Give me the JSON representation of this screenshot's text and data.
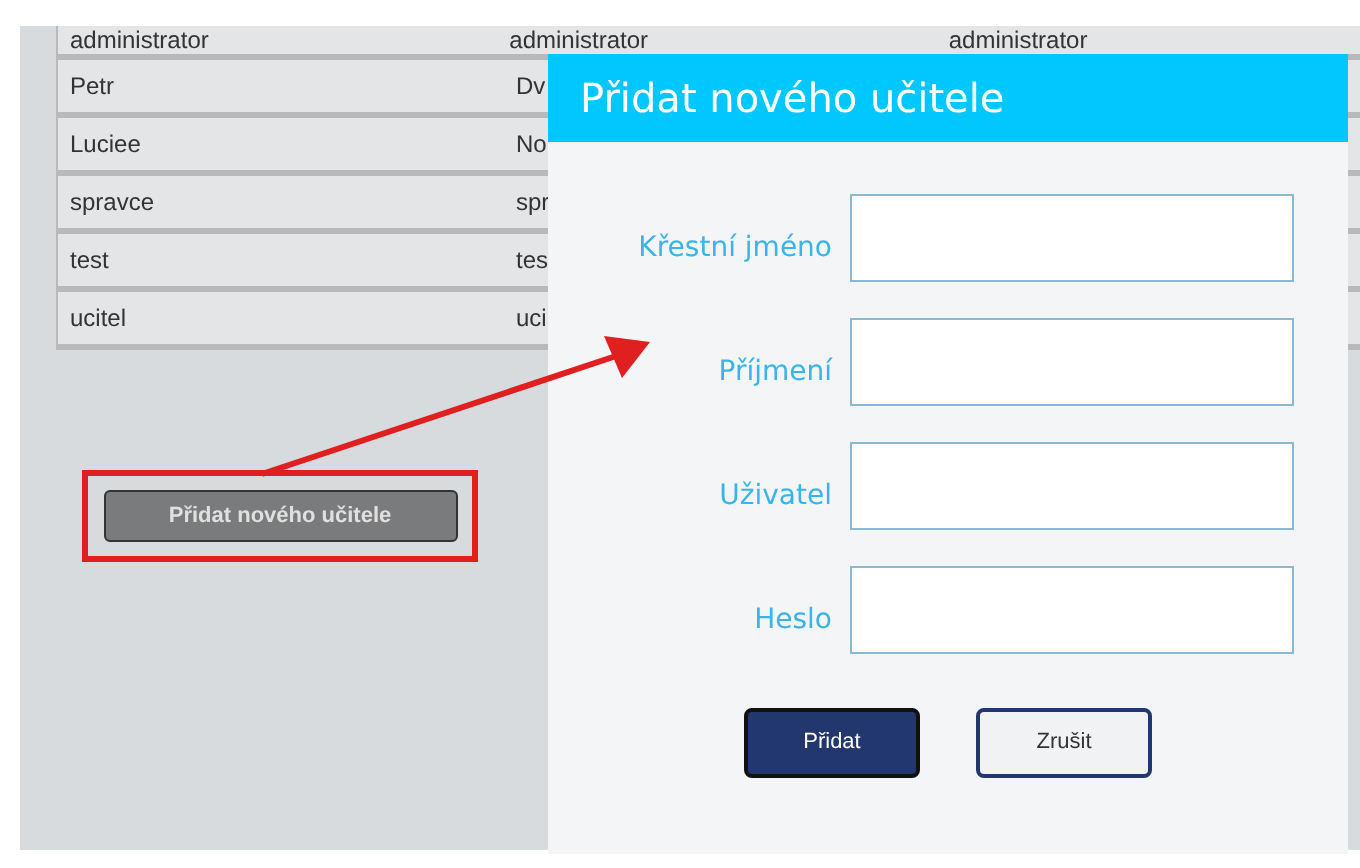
{
  "table": {
    "rows": [
      {
        "cells": [
          "administrator",
          "administrator",
          "administrator"
        ]
      },
      {
        "cells": [
          "Petr",
          "Dv"
        ]
      },
      {
        "cells": [
          "Luciee",
          "No"
        ]
      },
      {
        "cells": [
          "spravce",
          "spr"
        ]
      },
      {
        "cells": [
          "test",
          "tes"
        ]
      },
      {
        "cells": [
          "ucitel",
          "uci"
        ]
      }
    ]
  },
  "add_button": {
    "label": "Přidat nového učitele"
  },
  "dialog": {
    "title": "Přidat nového učitele",
    "fields": [
      {
        "label": "Křestní jméno"
      },
      {
        "label": "Příjmení"
      },
      {
        "label": "Uživatel"
      },
      {
        "label": "Heslo"
      }
    ],
    "buttons": [
      {
        "label": "Přidat",
        "kind": "primary"
      },
      {
        "label": "Zrušit",
        "kind": "secondary"
      }
    ]
  }
}
